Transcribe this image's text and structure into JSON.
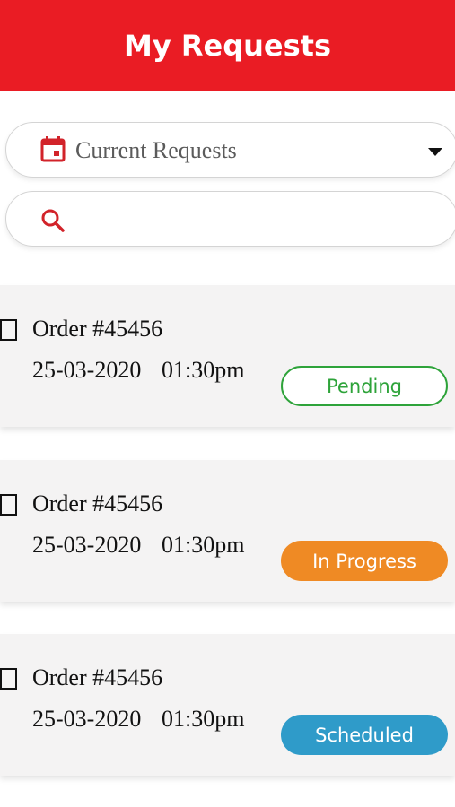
{
  "header": {
    "title": "My Requests"
  },
  "filter": {
    "icon": "calendar-icon",
    "selected": "Current Requests"
  },
  "search": {
    "icon": "search-icon",
    "value": "",
    "placeholder": ""
  },
  "colors": {
    "brand": "#ea1c24",
    "pending": "#2ea33a",
    "in_progress": "#ef8a24",
    "scheduled": "#2f9bc9"
  },
  "requests": [
    {
      "order": "Order #45456",
      "date": "25-03-2020",
      "time": "01:30pm",
      "status": "Pending"
    },
    {
      "order": "Order #45456",
      "date": "25-03-2020",
      "time": "01:30pm",
      "status": "In Progress"
    },
    {
      "order": "Order #45456",
      "date": "25-03-2020",
      "time": "01:30pm",
      "status": "Scheduled"
    }
  ]
}
